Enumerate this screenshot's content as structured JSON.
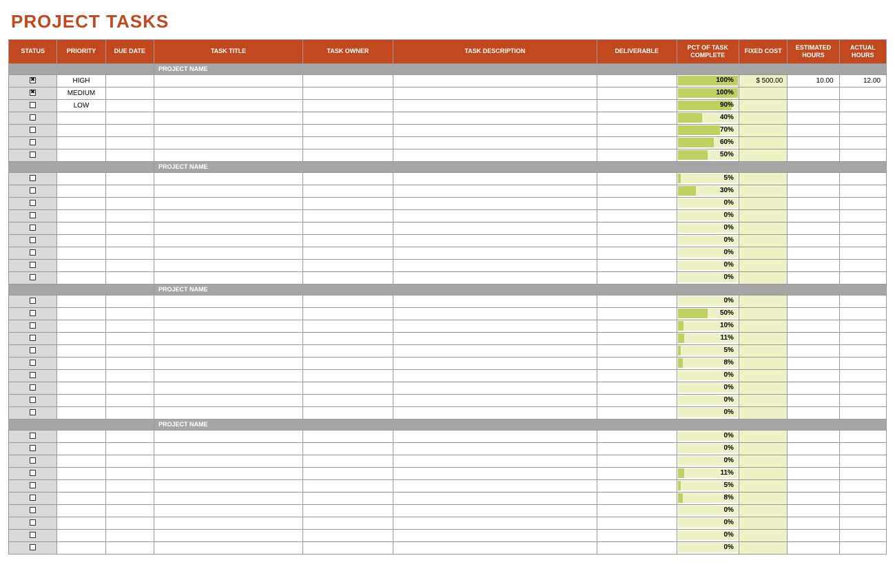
{
  "title": "PROJECT TASKS",
  "columns": {
    "status": "STATUS",
    "priority": "PRIORITY",
    "due": "DUE DATE",
    "title": "TASK TITLE",
    "owner": "TASK OWNER",
    "desc": "TASK DESCRIPTION",
    "deliv": "DELIVERABLE",
    "pct": "PCT OF TASK COMPLETE",
    "fixed": "FIXED COST",
    "est": "ESTIMATED HOURS",
    "act": "ACTUAL HOURS"
  },
  "sections": [
    {
      "name": "PROJECT NAME",
      "rows": [
        {
          "checked": true,
          "priority": "HIGH",
          "pct": 100,
          "fixed": "$     500.00",
          "est": "10.00",
          "act": "12.00"
        },
        {
          "checked": true,
          "priority": "MEDIUM",
          "pct": 100
        },
        {
          "checked": false,
          "priority": "LOW",
          "pct": 90
        },
        {
          "checked": false,
          "pct": 40
        },
        {
          "checked": false,
          "pct": 70
        },
        {
          "checked": false,
          "pct": 60
        },
        {
          "checked": false,
          "pct": 50
        }
      ]
    },
    {
      "name": "PROJECT NAME",
      "rows": [
        {
          "checked": false,
          "pct": 5
        },
        {
          "checked": false,
          "pct": 30
        },
        {
          "checked": false,
          "pct": 0
        },
        {
          "checked": false,
          "pct": 0
        },
        {
          "checked": false,
          "pct": 0
        },
        {
          "checked": false,
          "pct": 0
        },
        {
          "checked": false,
          "pct": 0
        },
        {
          "checked": false,
          "pct": 0
        },
        {
          "checked": false,
          "pct": 0
        }
      ]
    },
    {
      "name": "PROJECT NAME",
      "rows": [
        {
          "checked": false,
          "pct": 0
        },
        {
          "checked": false,
          "pct": 50
        },
        {
          "checked": false,
          "pct": 10
        },
        {
          "checked": false,
          "pct": 11
        },
        {
          "checked": false,
          "pct": 5
        },
        {
          "checked": false,
          "pct": 8
        },
        {
          "checked": false,
          "pct": 0
        },
        {
          "checked": false,
          "pct": 0
        },
        {
          "checked": false,
          "pct": 0
        },
        {
          "checked": false,
          "pct": 0
        }
      ]
    },
    {
      "name": "PROJECT NAME",
      "rows": [
        {
          "checked": false,
          "pct": 0
        },
        {
          "checked": false,
          "pct": 0
        },
        {
          "checked": false,
          "pct": 0
        },
        {
          "checked": false,
          "pct": 11
        },
        {
          "checked": false,
          "pct": 5
        },
        {
          "checked": false,
          "pct": 8
        },
        {
          "checked": false,
          "pct": 0
        },
        {
          "checked": false,
          "pct": 0
        },
        {
          "checked": false,
          "pct": 0
        },
        {
          "checked": false,
          "pct": 0
        }
      ]
    }
  ]
}
